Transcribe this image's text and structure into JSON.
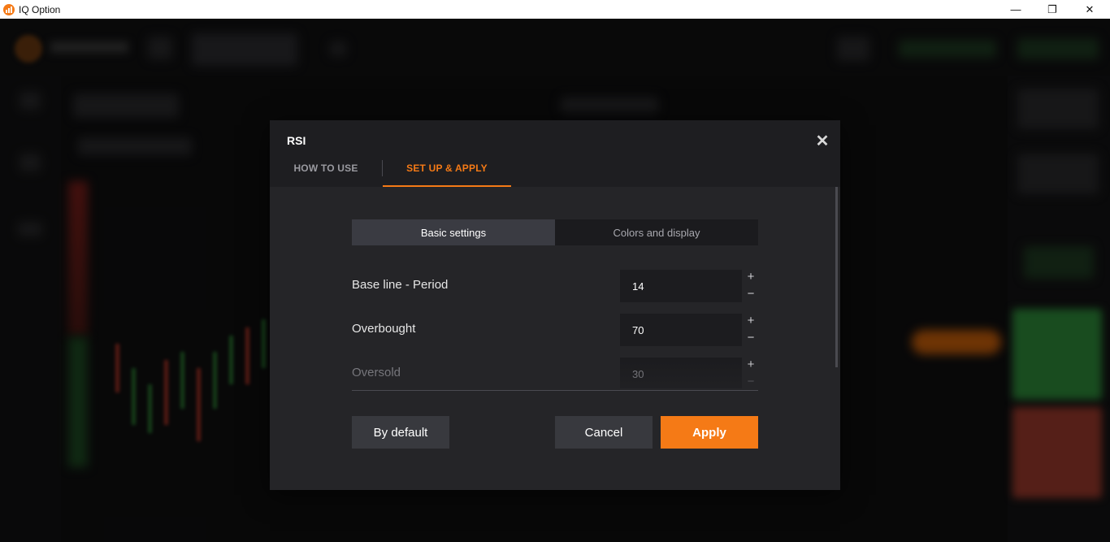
{
  "window": {
    "title": "IQ Option",
    "minimize_glyph": "—",
    "restore_glyph": "❐",
    "close_glyph": "✕"
  },
  "dialog": {
    "title": "RSI",
    "close_glyph": "✕",
    "tabs": [
      {
        "label": "HOW TO USE",
        "active": false
      },
      {
        "label": "SET UP & APPLY",
        "active": true
      }
    ],
    "segments": [
      {
        "label": "Basic settings",
        "active": true
      },
      {
        "label": "Colors and display",
        "active": false
      }
    ],
    "fields": [
      {
        "label": "Base line - Period",
        "value": "14"
      },
      {
        "label": "Overbought",
        "value": "70"
      },
      {
        "label": "Oversold",
        "value": "30"
      }
    ],
    "stepper": {
      "plus": "+",
      "minus": "−"
    },
    "buttons": {
      "by_default": "By default",
      "cancel": "Cancel",
      "apply": "Apply"
    }
  },
  "colors": {
    "accent": "#f57a16",
    "dialog_bg": "#252528",
    "header_bg": "#1e1e21",
    "input_bg": "#1c1c1f",
    "button_bg": "#38393e"
  }
}
